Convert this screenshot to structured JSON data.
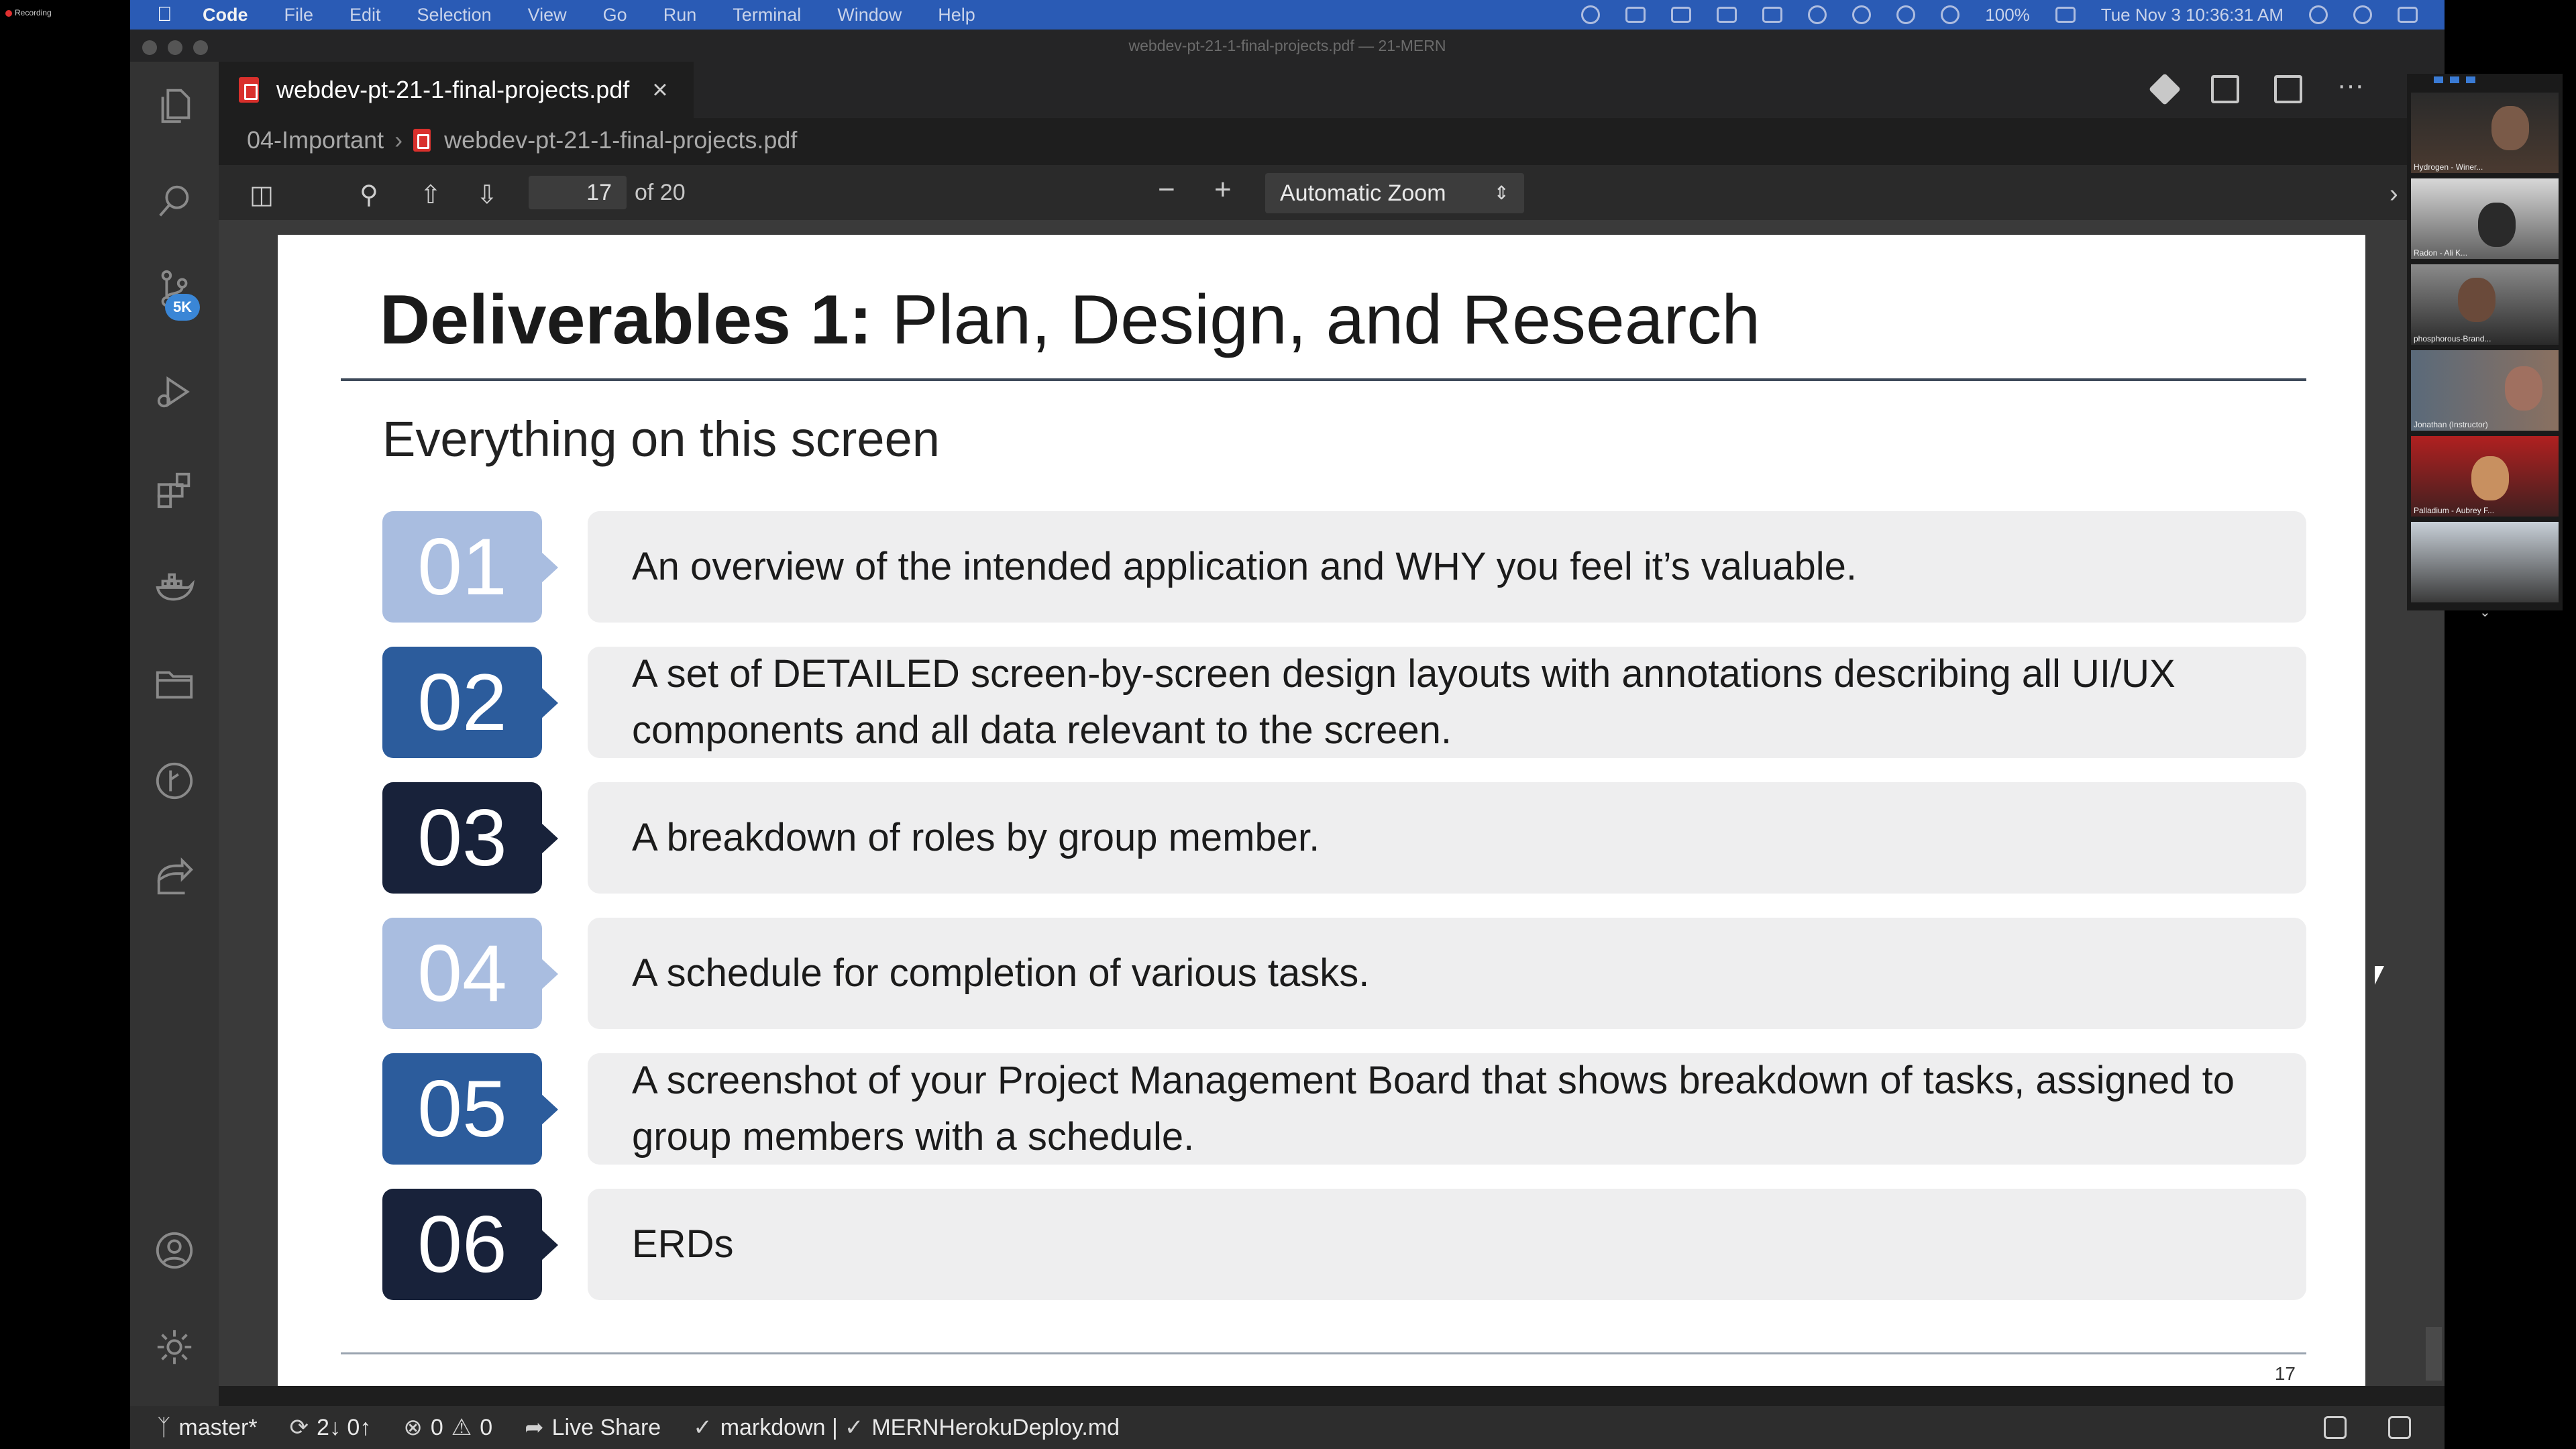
{
  "recording": {
    "label": "Recording"
  },
  "menubar": {
    "app": "Code",
    "items": [
      "File",
      "Edit",
      "Selection",
      "View",
      "Go",
      "Run",
      "Terminal",
      "Window",
      "Help"
    ],
    "battery": "100%",
    "datetime": "Tue Nov 3  10:36:31 AM"
  },
  "window": {
    "title": "webdev-pt-21-1-final-projects.pdf — 21-MERN"
  },
  "activity_bar": {
    "source_control_badge": "5K",
    "icons": [
      "files-icon",
      "search-icon",
      "source-control-icon",
      "run-debug-icon",
      "extensions-icon",
      "docker-icon",
      "folder-icon",
      "git-graph-icon",
      "live-share-icon",
      "account-icon",
      "settings-gear-icon"
    ]
  },
  "tab": {
    "label": "webdev-pt-21-1-final-projects.pdf",
    "close": "×"
  },
  "breadcrumb": {
    "folder": "04-Important",
    "file": "webdev-pt-21-1-final-projects.pdf"
  },
  "pdf_toolbar": {
    "page_current": "17",
    "page_total": "of 20",
    "zoom": "Automatic Zoom",
    "zoom_out": "−",
    "zoom_in": "+"
  },
  "slide": {
    "title_bold": "Deliverables 1:",
    "title_rest": " Plan, Design, and Research",
    "subtitle": "Everything on this screen",
    "items": [
      {
        "num": "01",
        "text": "An overview of the intended application and WHY you feel it’s valuable."
      },
      {
        "num": "02",
        "text": "A set of DETAILED screen-by-screen design layouts with annotations describing all UI/UX components and all data relevant to the screen."
      },
      {
        "num": "03",
        "text": "A breakdown of roles by group member."
      },
      {
        "num": "04",
        "text": "A schedule for completion of various tasks."
      },
      {
        "num": "05",
        "text": "A screenshot of your Project Management Board that shows breakdown of tasks, assigned to group members with a schedule."
      },
      {
        "num": "06",
        "text": "ERDs"
      }
    ],
    "page_number": "17"
  },
  "statusbar": {
    "branch": "master*",
    "sync": "2↓ 0↑",
    "errors": "0",
    "warnings": "0",
    "live_share": "Live Share",
    "language": "markdown | ",
    "file": "MERNHerokuDeploy.md"
  },
  "participants": [
    {
      "name": "Hydrogen - Winer..."
    },
    {
      "name": "Radon - Ali K..."
    },
    {
      "name": "phosphorous-Brand..."
    },
    {
      "name": "Jonathan (Instructor)"
    },
    {
      "name": "Palladium - Aubrey F..."
    },
    {
      "name": ""
    }
  ]
}
